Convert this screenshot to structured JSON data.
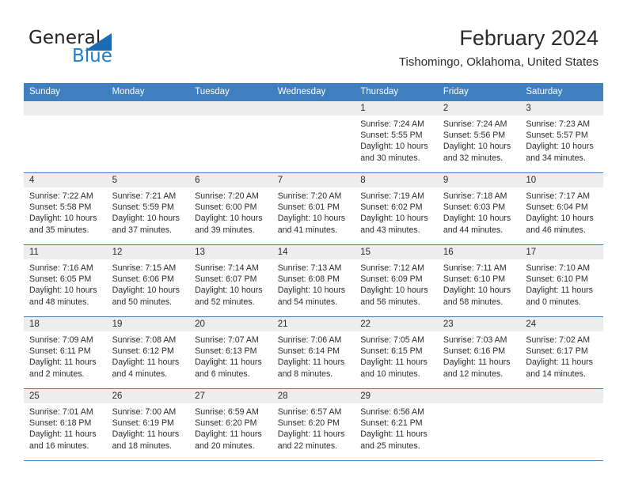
{
  "brand": {
    "name_part1": "General",
    "name_part2": "Blue",
    "triangle_color": "#1b6cb3",
    "blue_color": "#1b7fd4"
  },
  "header": {
    "title": "February 2024",
    "subtitle": "Tishomingo, Oklahoma, United States"
  },
  "theme": {
    "header_row_color": "#3f7fbf",
    "day_band_color": "#ededed",
    "text_color": "#2b2b2b"
  },
  "weekdays": [
    "Sunday",
    "Monday",
    "Tuesday",
    "Wednesday",
    "Thursday",
    "Friday",
    "Saturday"
  ],
  "weeks": [
    [
      {
        "empty": true
      },
      {
        "empty": true
      },
      {
        "empty": true
      },
      {
        "empty": true
      },
      {
        "day": "1",
        "sunrise": "Sunrise: 7:24 AM",
        "sunset": "Sunset: 5:55 PM",
        "daylight1": "Daylight: 10 hours",
        "daylight2": "and 30 minutes."
      },
      {
        "day": "2",
        "sunrise": "Sunrise: 7:24 AM",
        "sunset": "Sunset: 5:56 PM",
        "daylight1": "Daylight: 10 hours",
        "daylight2": "and 32 minutes."
      },
      {
        "day": "3",
        "sunrise": "Sunrise: 7:23 AM",
        "sunset": "Sunset: 5:57 PM",
        "daylight1": "Daylight: 10 hours",
        "daylight2": "and 34 minutes."
      }
    ],
    [
      {
        "day": "4",
        "sunrise": "Sunrise: 7:22 AM",
        "sunset": "Sunset: 5:58 PM",
        "daylight1": "Daylight: 10 hours",
        "daylight2": "and 35 minutes."
      },
      {
        "day": "5",
        "sunrise": "Sunrise: 7:21 AM",
        "sunset": "Sunset: 5:59 PM",
        "daylight1": "Daylight: 10 hours",
        "daylight2": "and 37 minutes."
      },
      {
        "day": "6",
        "sunrise": "Sunrise: 7:20 AM",
        "sunset": "Sunset: 6:00 PM",
        "daylight1": "Daylight: 10 hours",
        "daylight2": "and 39 minutes."
      },
      {
        "day": "7",
        "sunrise": "Sunrise: 7:20 AM",
        "sunset": "Sunset: 6:01 PM",
        "daylight1": "Daylight: 10 hours",
        "daylight2": "and 41 minutes."
      },
      {
        "day": "8",
        "sunrise": "Sunrise: 7:19 AM",
        "sunset": "Sunset: 6:02 PM",
        "daylight1": "Daylight: 10 hours",
        "daylight2": "and 43 minutes."
      },
      {
        "day": "9",
        "sunrise": "Sunrise: 7:18 AM",
        "sunset": "Sunset: 6:03 PM",
        "daylight1": "Daylight: 10 hours",
        "daylight2": "and 44 minutes."
      },
      {
        "day": "10",
        "sunrise": "Sunrise: 7:17 AM",
        "sunset": "Sunset: 6:04 PM",
        "daylight1": "Daylight: 10 hours",
        "daylight2": "and 46 minutes."
      }
    ],
    [
      {
        "day": "11",
        "sunrise": "Sunrise: 7:16 AM",
        "sunset": "Sunset: 6:05 PM",
        "daylight1": "Daylight: 10 hours",
        "daylight2": "and 48 minutes."
      },
      {
        "day": "12",
        "sunrise": "Sunrise: 7:15 AM",
        "sunset": "Sunset: 6:06 PM",
        "daylight1": "Daylight: 10 hours",
        "daylight2": "and 50 minutes."
      },
      {
        "day": "13",
        "sunrise": "Sunrise: 7:14 AM",
        "sunset": "Sunset: 6:07 PM",
        "daylight1": "Daylight: 10 hours",
        "daylight2": "and 52 minutes."
      },
      {
        "day": "14",
        "sunrise": "Sunrise: 7:13 AM",
        "sunset": "Sunset: 6:08 PM",
        "daylight1": "Daylight: 10 hours",
        "daylight2": "and 54 minutes."
      },
      {
        "day": "15",
        "sunrise": "Sunrise: 7:12 AM",
        "sunset": "Sunset: 6:09 PM",
        "daylight1": "Daylight: 10 hours",
        "daylight2": "and 56 minutes."
      },
      {
        "day": "16",
        "sunrise": "Sunrise: 7:11 AM",
        "sunset": "Sunset: 6:10 PM",
        "daylight1": "Daylight: 10 hours",
        "daylight2": "and 58 minutes."
      },
      {
        "day": "17",
        "sunrise": "Sunrise: 7:10 AM",
        "sunset": "Sunset: 6:10 PM",
        "daylight1": "Daylight: 11 hours",
        "daylight2": "and 0 minutes."
      }
    ],
    [
      {
        "day": "18",
        "sunrise": "Sunrise: 7:09 AM",
        "sunset": "Sunset: 6:11 PM",
        "daylight1": "Daylight: 11 hours",
        "daylight2": "and 2 minutes."
      },
      {
        "day": "19",
        "sunrise": "Sunrise: 7:08 AM",
        "sunset": "Sunset: 6:12 PM",
        "daylight1": "Daylight: 11 hours",
        "daylight2": "and 4 minutes."
      },
      {
        "day": "20",
        "sunrise": "Sunrise: 7:07 AM",
        "sunset": "Sunset: 6:13 PM",
        "daylight1": "Daylight: 11 hours",
        "daylight2": "and 6 minutes."
      },
      {
        "day": "21",
        "sunrise": "Sunrise: 7:06 AM",
        "sunset": "Sunset: 6:14 PM",
        "daylight1": "Daylight: 11 hours",
        "daylight2": "and 8 minutes."
      },
      {
        "day": "22",
        "sunrise": "Sunrise: 7:05 AM",
        "sunset": "Sunset: 6:15 PM",
        "daylight1": "Daylight: 11 hours",
        "daylight2": "and 10 minutes."
      },
      {
        "day": "23",
        "sunrise": "Sunrise: 7:03 AM",
        "sunset": "Sunset: 6:16 PM",
        "daylight1": "Daylight: 11 hours",
        "daylight2": "and 12 minutes."
      },
      {
        "day": "24",
        "sunrise": "Sunrise: 7:02 AM",
        "sunset": "Sunset: 6:17 PM",
        "daylight1": "Daylight: 11 hours",
        "daylight2": "and 14 minutes."
      }
    ],
    [
      {
        "day": "25",
        "sunrise": "Sunrise: 7:01 AM",
        "sunset": "Sunset: 6:18 PM",
        "daylight1": "Daylight: 11 hours",
        "daylight2": "and 16 minutes."
      },
      {
        "day": "26",
        "sunrise": "Sunrise: 7:00 AM",
        "sunset": "Sunset: 6:19 PM",
        "daylight1": "Daylight: 11 hours",
        "daylight2": "and 18 minutes."
      },
      {
        "day": "27",
        "sunrise": "Sunrise: 6:59 AM",
        "sunset": "Sunset: 6:20 PM",
        "daylight1": "Daylight: 11 hours",
        "daylight2": "and 20 minutes."
      },
      {
        "day": "28",
        "sunrise": "Sunrise: 6:57 AM",
        "sunset": "Sunset: 6:20 PM",
        "daylight1": "Daylight: 11 hours",
        "daylight2": "and 22 minutes."
      },
      {
        "day": "29",
        "sunrise": "Sunrise: 6:56 AM",
        "sunset": "Sunset: 6:21 PM",
        "daylight1": "Daylight: 11 hours",
        "daylight2": "and 25 minutes."
      },
      {
        "empty": true
      },
      {
        "empty": true
      }
    ]
  ]
}
